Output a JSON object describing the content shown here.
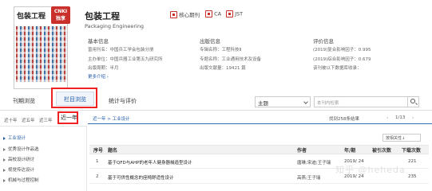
{
  "journal": {
    "cover_logo_text": "包装工程",
    "badge_text": "CNKI 独享",
    "title": "包装工程",
    "subtitle": "Packaging Engineering",
    "tags": [
      "核心期刊",
      "CA",
      "JST"
    ]
  },
  "basic_info": {
    "heading": "基本信息",
    "rows": [
      {
        "label": "曾用刊名：",
        "value": "中国兵工学会包装分册"
      },
      {
        "label": "主办单位：",
        "value": "中国兵器工业第五九研究所"
      },
      {
        "label": "出版周期：",
        "value": "半月"
      }
    ],
    "more": "更多介绍"
  },
  "publish_info": {
    "heading": "出版信息",
    "rows": [
      {
        "label": "专辑名称：",
        "value": "工程科技Ⅱ"
      },
      {
        "label": "专题名称：",
        "value": "工业通用技术及设备"
      },
      {
        "label": "出版文献量：",
        "value": "19421 篇"
      }
    ]
  },
  "eval_info": {
    "heading": "评价信息",
    "rows": [
      {
        "label": "(2019)复合影响因子：",
        "value": "0.995"
      },
      {
        "label": "(2019)综合影响因子：",
        "value": "0.679"
      },
      {
        "label": "该刊被以下数据库收录：",
        "value": ""
      }
    ]
  },
  "tabs": [
    "刊期浏览",
    "栏目浏览",
    "统计与评价"
  ],
  "search": {
    "select_value": "主题",
    "placeholder": "本刊内检索"
  },
  "year_filters": [
    "近十年",
    "近五年",
    "近三年",
    "近一年"
  ],
  "breadcrumb": "近一年 > 工业设计",
  "found_text": "找到258条结果",
  "pager": "1/13",
  "sort_label": "按相关性↓",
  "sidebar": [
    "工业设计",
    "优秀设计作品选",
    "高校设计研讨",
    "视觉传达设计",
    "机械与过程控制"
  ],
  "table": {
    "headers": [
      "序号",
      "题名",
      "作者",
      "年/期",
      "被引次数",
      "下载次数"
    ],
    "rows": [
      {
        "no": "1",
        "title": "基于QFD与AHP的老年人健身器械造型设计",
        "author": "唐琳;宋迪;王子瑞",
        "issue": "2019/ 24",
        "cited": "",
        "downloads": "221"
      },
      {
        "no": "2",
        "title": "基于可供性概念的座椅舒适性设计",
        "author": "高燕;王子瑞",
        "issue": "2019/ 24",
        "cited": "",
        "downloads": "235"
      }
    ]
  },
  "watermark": "知乎 @heheda",
  "colors": {
    "accent": "#1f5aa8",
    "highlight": "#e22222",
    "brand_red": "#c9302c"
  }
}
